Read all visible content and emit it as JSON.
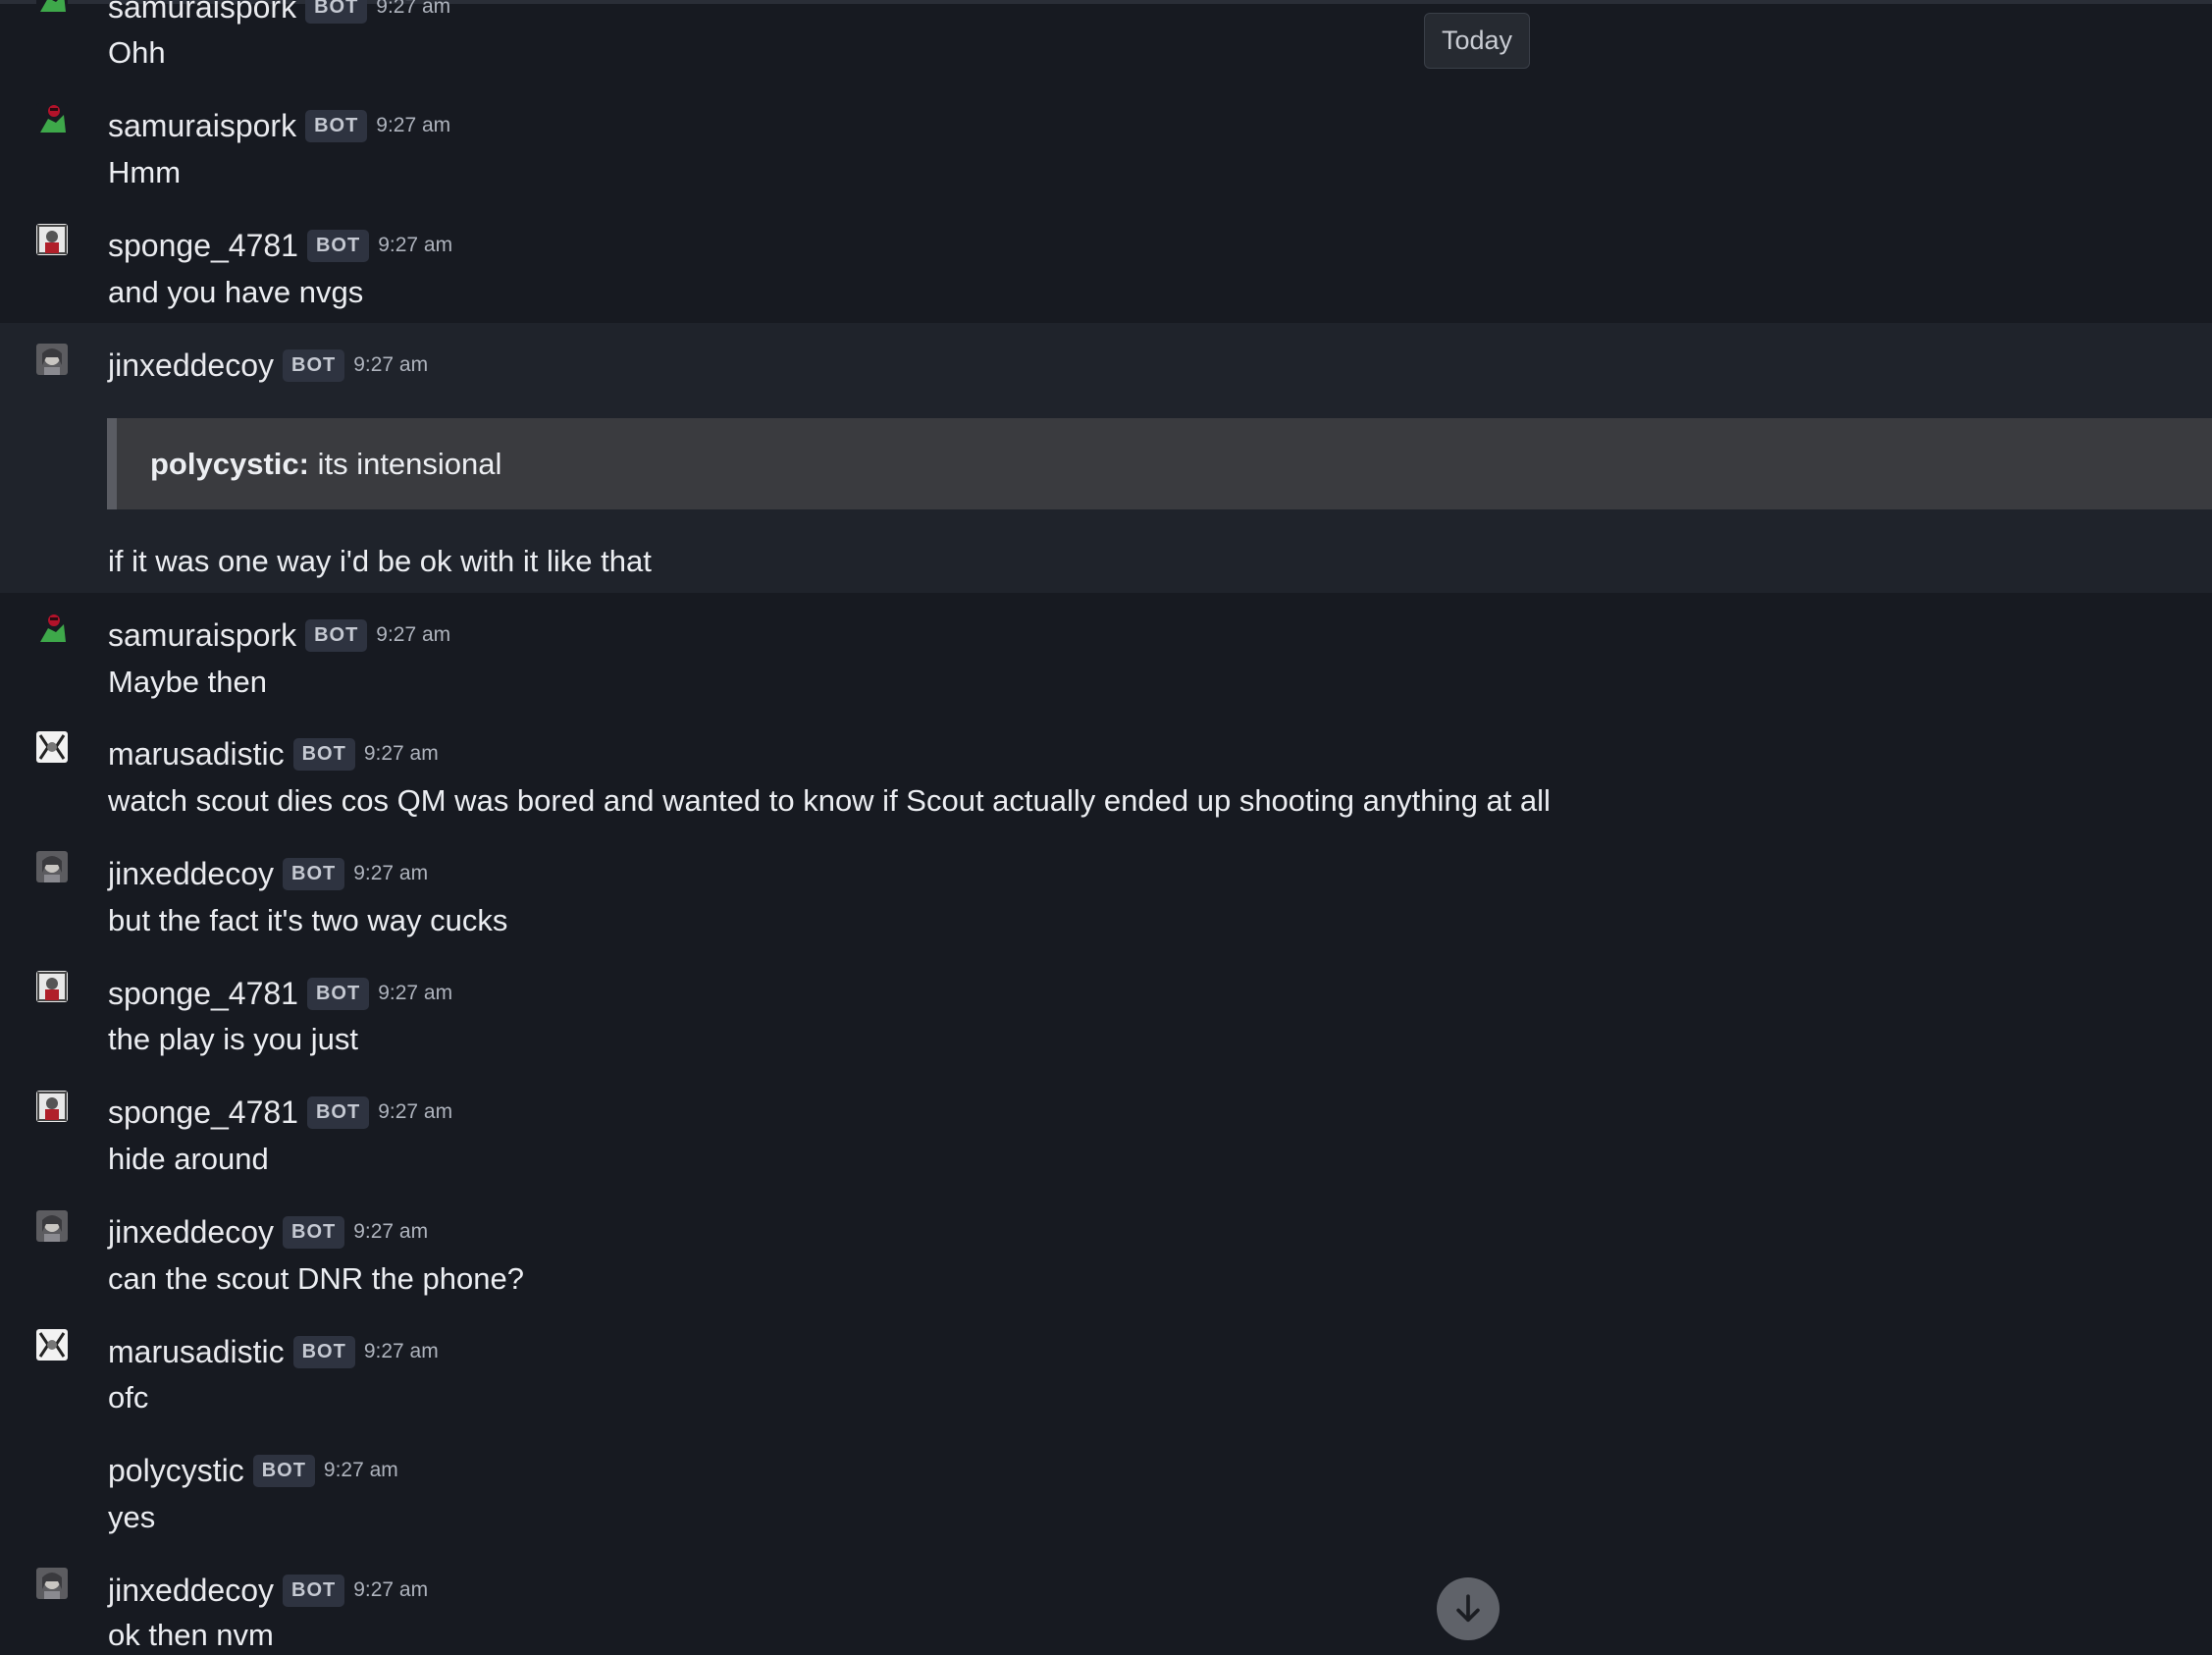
{
  "date_divider": "Today",
  "bot_label": "BOT",
  "messages": [
    {
      "user": "samuraispork",
      "time": "9:27 am",
      "text": "Ohh",
      "avatar": "samuraispork-avatar"
    },
    {
      "user": "samuraispork",
      "time": "9:27 am",
      "text": "Hmm",
      "avatar": "samuraispork-avatar"
    },
    {
      "user": "sponge_4781",
      "time": "9:27 am",
      "text": "and you have nvgs",
      "avatar": "sponge-avatar"
    },
    {
      "user": "jinxeddecoy",
      "time": "9:27 am",
      "text": "if it was one way i'd be ok with it like that",
      "avatar": "jinxeddecoy-avatar",
      "quote": {
        "author": "polycystic:",
        "text": "its intensional"
      }
    },
    {
      "user": "samuraispork",
      "time": "9:27 am",
      "text": "Maybe then",
      "avatar": "samuraispork-avatar"
    },
    {
      "user": "marusadistic",
      "time": "9:27 am",
      "text": "watch scout dies cos QM was bored and wanted to know if Scout actually ended up shooting anything at all",
      "avatar": "marusadistic-avatar"
    },
    {
      "user": "jinxeddecoy",
      "time": "9:27 am",
      "text": "but the fact it's two way cucks",
      "avatar": "jinxeddecoy-avatar"
    },
    {
      "user": "sponge_4781",
      "time": "9:27 am",
      "text": "the play is you just",
      "avatar": "sponge-avatar"
    },
    {
      "user": "sponge_4781",
      "time": "9:27 am",
      "text": "hide around",
      "avatar": "sponge-avatar"
    },
    {
      "user": "jinxeddecoy",
      "time": "9:27 am",
      "text": "can the scout DNR the phone?",
      "avatar": "jinxeddecoy-avatar"
    },
    {
      "user": "marusadistic",
      "time": "9:27 am",
      "text": "ofc",
      "avatar": "marusadistic-avatar"
    },
    {
      "user": "polycystic",
      "time": "9:27 am",
      "text": "yes",
      "avatar": ""
    },
    {
      "user": "jinxeddecoy",
      "time": "9:27 am",
      "text": "ok then nvm",
      "avatar": "jinxeddecoy-avatar"
    }
  ],
  "scroll_button_icon": "arrow-down-icon",
  "colors": {
    "background": "#171a21",
    "highlight": "#1f232b",
    "quote_bg": "#3a3b3f",
    "bot_badge": "#2e3340"
  }
}
